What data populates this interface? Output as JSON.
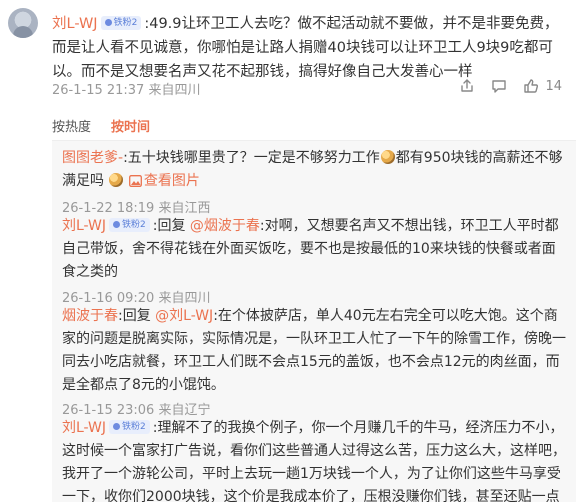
{
  "main_comment": {
    "username": "刘L-WJ",
    "badge": "铁粉2",
    "text": ":49.9让环卫工人去吃？做不起活动就不要做，并不是非要免费，而是让人看不见诚意，你哪怕是让路人捐赠40块钱可以让环卫工人9块9吃都可以。而不是又想要名声又花不起那钱，搞得好像自己大发善心一样",
    "time": "26-1-15 21:37",
    "location": "来自四川",
    "like_count": "14"
  },
  "sort_tabs": {
    "by_hot": "按热度",
    "by_time": "按时间"
  },
  "replies": [
    {
      "username": "图图老爹-",
      "text_1": ":五十块钱哪里贵了？一定是不够努力工作",
      "text_2": "都有950块钱的高薪还不够满足吗",
      "view_picture": "查看图片",
      "time": "26-1-22 18:19",
      "location": "来自江西"
    },
    {
      "username": "刘L-WJ",
      "badge": "铁粉2",
      "reply_word": ":回复",
      "mention": "@烟波于春",
      "text": ":对啊，又想要名声又不想出钱，环卫工人平时都自己带饭，舍不得花钱在外面买饭吃，要不也是按最低的10来块钱的快餐或者面食之类的",
      "time": "26-1-16 09:20",
      "location": "来自四川"
    },
    {
      "username": "烟波于春",
      "reply_word": ":回复",
      "mention": "@刘L-WJ",
      "text": ":在个体披萨店，单人40元左右完全可以吃大饱。这个商家的问题是脱离实际，实际情况是，一队环卫工人忙了一下午的除雪工作，傍晚一同去小吃店就餐，环卫工人们既不会点15元的盖饭，也不会点12元的肉丝面，而是全都点了8元的小馄饨。",
      "time": "26-1-15 23:06",
      "location": "来自辽宁"
    },
    {
      "username": "刘L-WJ",
      "badge": "铁粉2",
      "text": ":理解不了的我换个例子，你一个月赚几千的牛马，经济压力不小，这时候一个富家打广告说，看你们这些普通人过得这么苦，压力这么大，这样吧，我开了一个游轮公司，平时上去玩一趟1万块钱一个人，为了让你们这些牛马享受一下，收你们2000块钱，这个价是我成本价了，压根没赚你们钱，甚至还贴一点"
    }
  ],
  "colors": {
    "accent": "#eb7350",
    "meta": "#999999",
    "reply_bg": "#f7f7f7"
  },
  "icons": [
    "avatar",
    "fan-badge-icon",
    "share-icon",
    "comment-icon",
    "like-icon",
    "emoji-icon",
    "picture-icon"
  ]
}
